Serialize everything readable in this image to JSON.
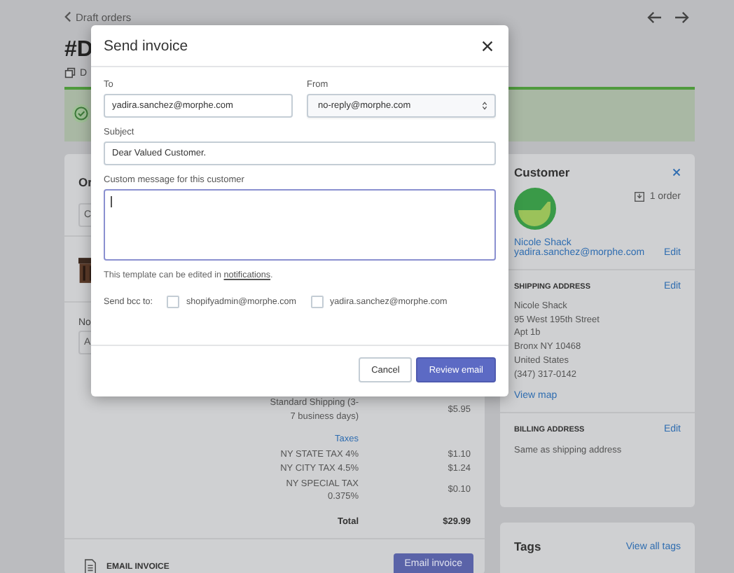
{
  "page": {
    "back_link": "Draft orders",
    "title": "#D",
    "duplicate": "D",
    "order_card": {
      "heading": "Or",
      "search_fragment": "C",
      "notes_label": "No",
      "notes_fragment": "A"
    },
    "summary": [
      {
        "kind": "item",
        "label": "Standard Shipping (3-7 business days)",
        "amount": "$5.95"
      },
      {
        "kind": "heading",
        "label": "Taxes"
      },
      {
        "kind": "item",
        "label": "NY STATE TAX 4%",
        "amount": "$1.10"
      },
      {
        "kind": "item",
        "label": "NY CITY TAX 4.5%",
        "amount": "$1.24"
      },
      {
        "kind": "item",
        "label": "NY SPECIAL TAX 0.375%",
        "amount": "$0.10"
      },
      {
        "kind": "total",
        "label": "Total",
        "amount": "$29.99"
      }
    ],
    "email_invoice": {
      "label": "EMAIL INVOICE",
      "button": "Email invoice"
    },
    "customer": {
      "heading": "Customer",
      "orders": "1 order",
      "name": "Nicole Shack",
      "email": "yadira.sanchez@morphe.com",
      "edit": "Edit"
    },
    "shipping_address": {
      "heading": "SHIPPING ADDRESS",
      "edit": "Edit",
      "lines": [
        "Nicole Shack",
        "95 West 195th Street",
        "Apt 1b",
        "Bronx NY 10468",
        "United States",
        "(347) 317-0142"
      ],
      "map_link": "View map"
    },
    "billing_address": {
      "heading": "BILLING ADDRESS",
      "edit": "Edit",
      "text": "Same as shipping address"
    },
    "tags": {
      "heading": "Tags",
      "link": "View all tags"
    }
  },
  "modal": {
    "title": "Send invoice",
    "to": {
      "label": "To",
      "value": "yadira.sanchez@morphe.com"
    },
    "from": {
      "label": "From",
      "value": "no-reply@morphe.com"
    },
    "subject": {
      "label": "Subject",
      "value": "Dear Valued Customer."
    },
    "message": {
      "label": "Custom message for this customer"
    },
    "template_note": {
      "text": "This template can be edited in",
      "link": "notifications",
      "end": "."
    },
    "bcc": {
      "label": "Send bcc to:",
      "options": [
        {
          "label": "shopifyadmin@morphe.com",
          "checked": false
        },
        {
          "label": "yadira.sanchez@morphe.com",
          "checked": false
        }
      ]
    },
    "buttons": {
      "cancel": "Cancel",
      "primary": "Review email"
    }
  }
}
